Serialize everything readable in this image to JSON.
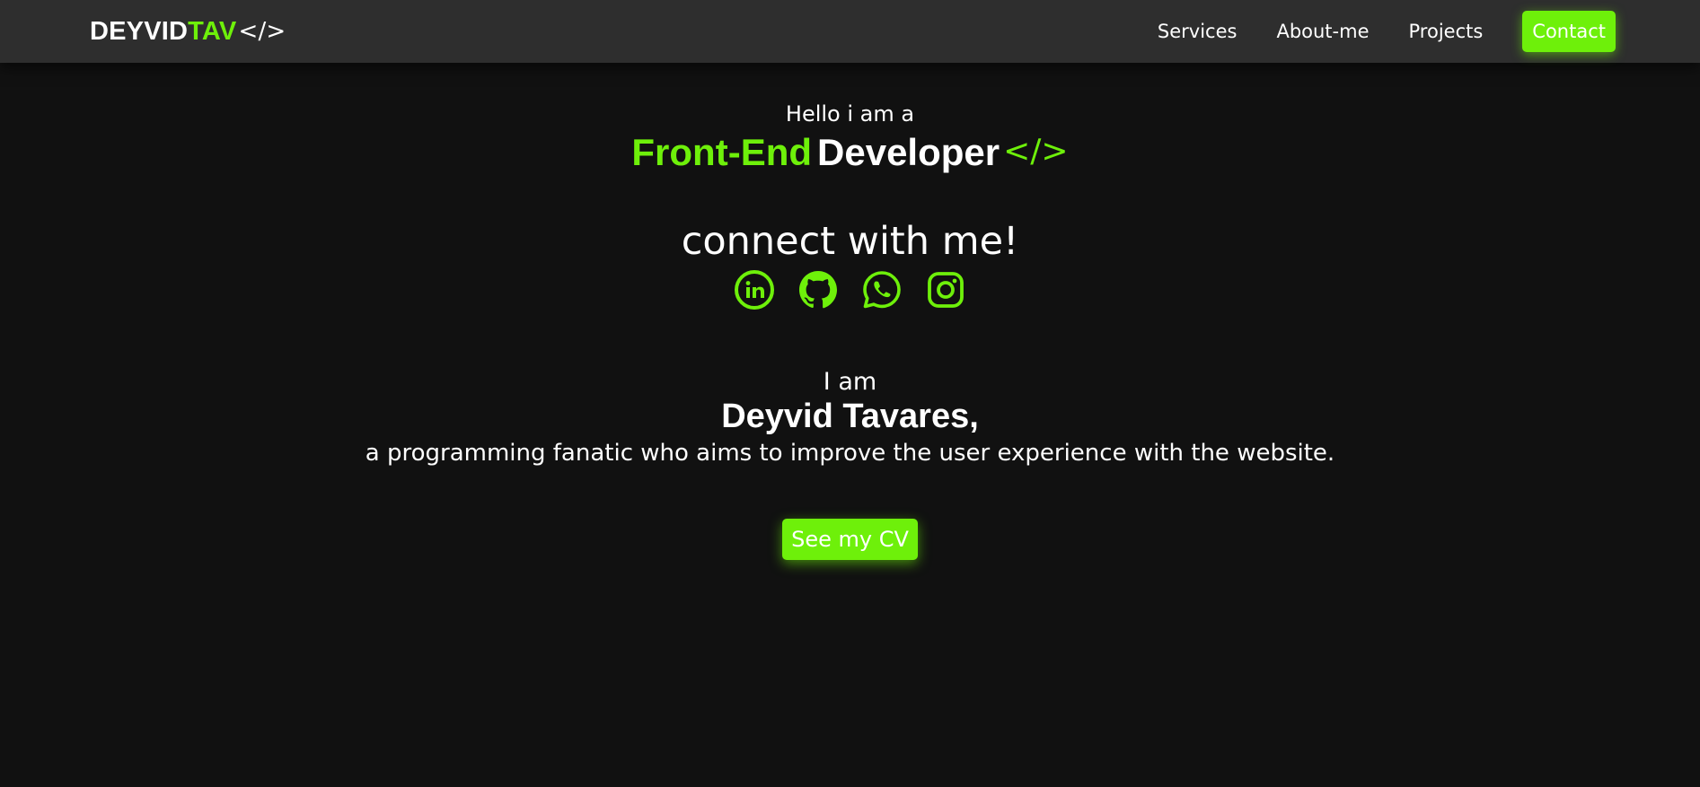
{
  "nav": {
    "logo_part1": "DEYVID",
    "logo_part2": "TAV",
    "logo_tag": "</>",
    "links": [
      "Services",
      "About-me",
      "Projects"
    ],
    "contact_label": "Contact"
  },
  "hero": {
    "greeting": "Hello i am a",
    "role_highlight": "Front-End",
    "role_rest": "Developer",
    "role_tag": "</>",
    "connect_title": "connect with me!",
    "socials": [
      "linkedin-icon",
      "github-icon",
      "whatsapp-icon",
      "instagram-icon"
    ],
    "iam": "I am",
    "name": "Deyvid Tavares,",
    "description": "a programming fanatic who aims to improve the user experience with the website.",
    "cv_label": "See my CV"
  },
  "colors": {
    "background": "#111111",
    "navbar": "#2e2e2e",
    "accent": "#6ef00a",
    "text": "#ffffff"
  }
}
